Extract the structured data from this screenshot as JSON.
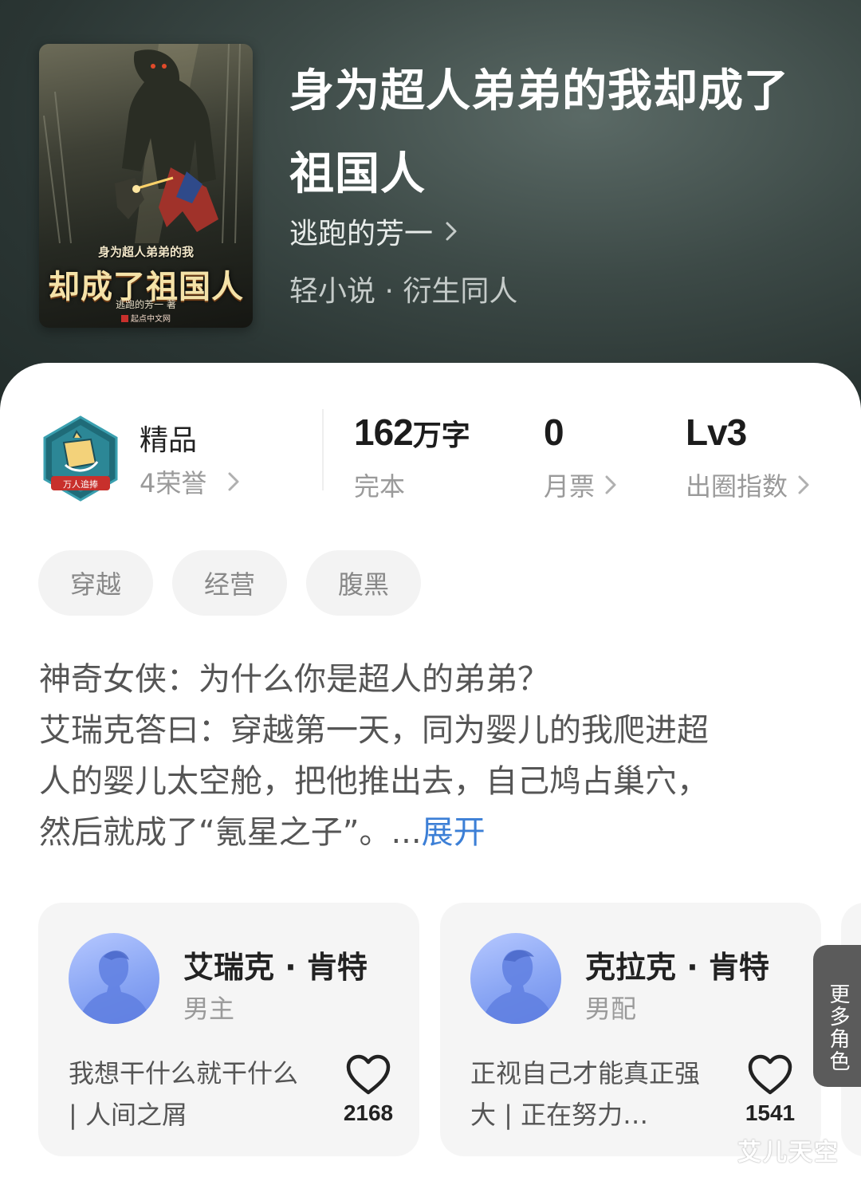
{
  "book": {
    "title": "身为超人弟弟的我却成了祖国人",
    "author": "逃跑的芳一",
    "genre": "轻小说 · 衍生同人",
    "cover": {
      "subtitle": "身为超人弟弟的我",
      "title": "却成了祖国人",
      "author": "逃跑的芳一 著",
      "publisher": "起点中文网"
    }
  },
  "stats": {
    "honor": {
      "title": "精品",
      "subtitle": "4荣誉",
      "badge_text": "万人追捧"
    },
    "words": {
      "value": "162",
      "unit": "万字",
      "label": "完本"
    },
    "monthly_ticket": {
      "value": "0",
      "label": "月票"
    },
    "popularity": {
      "value": "Lv3",
      "label": "出圈指数"
    }
  },
  "tags": [
    "穿越",
    "经营",
    "腹黑"
  ],
  "description": {
    "lines": [
      "神奇女侠：为什么你是超人的弟弟？",
      "艾瑞克答曰：穿越第一天，同为婴儿的我爬进超",
      "人的婴儿太空舱，把他推出去，自己鸠占巢穴，",
      "然后就成了“氪星之子”。..."
    ],
    "expand_label": "展开"
  },
  "characters": [
    {
      "name": "艾瑞克 · 肯特",
      "role": "男主",
      "quote": "我想干什么就干什么 | 人间之屑",
      "likes": "2168"
    },
    {
      "name": "克拉克 · 肯特",
      "role": "男配",
      "quote": "正视自己才能真正强大 | 正在努力…",
      "likes": "1541"
    }
  ],
  "more_roles_label": "更多角色",
  "watermark": "艾儿天空",
  "colors": {
    "header_bg": "#3d4a47",
    "expand_link": "#3c7fd6",
    "tag_bg": "#f3f3f3",
    "card_bg": "#f5f5f5",
    "avatar_blue": "#8aa6f4"
  }
}
